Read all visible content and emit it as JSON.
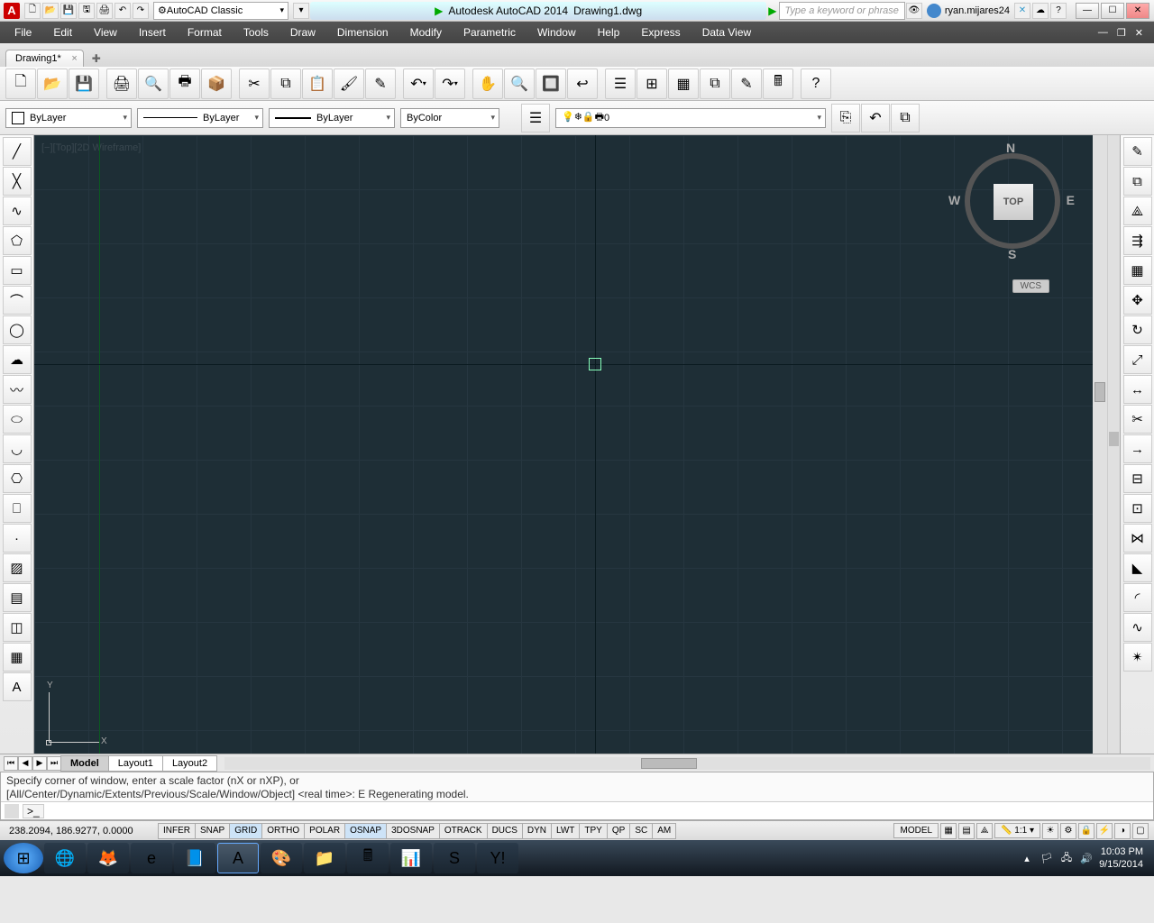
{
  "titlebar": {
    "app_letter": "A",
    "workspace": "AutoCAD Classic",
    "product": "Autodesk AutoCAD 2014",
    "file": "Drawing1.dwg",
    "search_placeholder": "Type a keyword or phrase",
    "user": "ryan.mijares24"
  },
  "menubar": [
    "File",
    "Edit",
    "View",
    "Insert",
    "Format",
    "Tools",
    "Draw",
    "Dimension",
    "Modify",
    "Parametric",
    "Window",
    "Help",
    "Express",
    "Data View"
  ],
  "doctab": {
    "name": "Drawing1*",
    "close": "×"
  },
  "toolbar_std_icons": [
    "new-icon",
    "open-icon",
    "save-icon",
    "print-icon",
    "plot-preview-icon",
    "publish-icon",
    "3dprint-icon",
    "cut-icon",
    "copy-icon",
    "paste-icon",
    "matchprop-icon",
    "blockeditor-icon",
    "undo-icon",
    "redo-icon",
    "pan-icon",
    "zoom-realtime-icon",
    "zoom-window-icon",
    "zoom-previous-icon",
    "properties-icon",
    "designcenter-icon",
    "toolpalettes-icon",
    "sheetset-icon",
    "markup-icon",
    "quickcalc-icon",
    "help-icon"
  ],
  "toolbar_std_glyphs": [
    "🗋",
    "📂",
    "💾",
    "🖨",
    "🔍",
    "🖶",
    "📦",
    "✂",
    "⧉",
    "📋",
    "🖌",
    "✎",
    "↶",
    "↷",
    "✋",
    "🔍",
    "🔲",
    "↩",
    "☰",
    "⊞",
    "▦",
    "⧉",
    "✎",
    "🖩",
    "?"
  ],
  "props": {
    "color": "ByLayer",
    "linetype": "ByLayer",
    "lineweight": "ByLayer",
    "plotstyle": "ByColor",
    "layer": "0"
  },
  "draw_icons": [
    "line-icon",
    "construction-line-icon",
    "polyline-icon",
    "polygon-icon",
    "rectangle-icon",
    "arc-icon",
    "circle-icon",
    "revcloud-icon",
    "spline-icon",
    "ellipse-icon",
    "ellipse-arc-icon",
    "insert-block-icon",
    "make-block-icon",
    "point-icon",
    "hatch-icon",
    "gradient-icon",
    "region-icon",
    "table-icon",
    "mtext-icon"
  ],
  "draw_glyphs": [
    "╱",
    "╳",
    "∿",
    "⬠",
    "▭",
    "⌒",
    "◯",
    "☁",
    "〰",
    "⬭",
    "◡",
    "⎔",
    "⎕",
    "·",
    "▨",
    "▤",
    "◫",
    "▦",
    "A"
  ],
  "modify_icons": [
    "erase-icon",
    "copy-icon",
    "mirror-icon",
    "offset-icon",
    "array-icon",
    "move-icon",
    "rotate-icon",
    "scale-icon",
    "stretch-icon",
    "trim-icon",
    "extend-icon",
    "break-at-point-icon",
    "break-icon",
    "join-icon",
    "chamfer-icon",
    "fillet-icon",
    "blend-icon",
    "explode-icon"
  ],
  "modify_glyphs": [
    "✎",
    "⧉",
    "⟁",
    "⇶",
    "▦",
    "✥",
    "↻",
    "⤢",
    "↔",
    "✂",
    "→",
    "⊟",
    "⊡",
    "⋈",
    "◣",
    "◜",
    "∿",
    "✴"
  ],
  "viewport": {
    "label": "[−][Top][2D Wireframe]",
    "cube": "TOP",
    "wcs": "WCS",
    "n": "N",
    "s": "S",
    "e": "E",
    "w": "W",
    "y": "Y",
    "x": "X"
  },
  "model_tabs": {
    "nav": [
      "⏮",
      "◀",
      "▶",
      "⏭"
    ],
    "model": "Model",
    "layout1": "Layout1",
    "layout2": "Layout2"
  },
  "cmd": {
    "line1": "Specify corner of window, enter a scale factor (nX or nXP), or",
    "line2": "[All/Center/Dynamic/Extents/Previous/Scale/Window/Object] <real time>: E Regenerating model.",
    "prompt": ">_"
  },
  "status": {
    "coords": "238.2094, 186.9277, 0.0000",
    "toggles": [
      "INFER",
      "SNAP",
      "GRID",
      "ORTHO",
      "POLAR",
      "OSNAP",
      "3DOSNAP",
      "OTRACK",
      "DUCS",
      "DYN",
      "LWT",
      "TPY",
      "QP",
      "SC",
      "AM"
    ],
    "on": [
      "GRID",
      "OSNAP"
    ],
    "model": "MODEL",
    "scale": "1:1"
  },
  "taskbar": {
    "apps": [
      "start-icon",
      "chrome-icon",
      "firefox-icon",
      "ie-icon",
      "dock-icon",
      "autocad-icon",
      "paint-icon",
      "files-icon",
      "calc-icon",
      "excel-icon",
      "skype-icon",
      "yahoo-icon"
    ],
    "glyphs": [
      "⊞",
      "🌐",
      "🦊",
      "e",
      "📘",
      "A",
      "🎨",
      "📁",
      "🖩",
      "📊",
      "S",
      "Y!"
    ],
    "time": "10:03 PM",
    "date": "9/15/2014"
  }
}
